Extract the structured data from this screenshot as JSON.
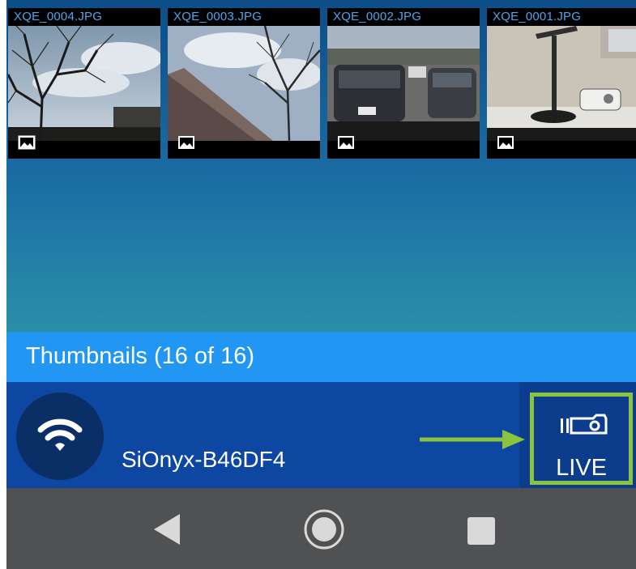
{
  "thumbnails": [
    {
      "filename": "XQE_0004.JPG",
      "icon": "image-icon"
    },
    {
      "filename": "XQE_0003.JPG",
      "icon": "image-icon"
    },
    {
      "filename": "XQE_0002.JPG",
      "icon": "image-icon"
    },
    {
      "filename": "XQE_0001.JPG",
      "icon": "image-icon"
    }
  ],
  "banner": {
    "title": "Thumbnails (16 of 16)"
  },
  "connection": {
    "ssid": "SiOnyx-B46DF4",
    "icon": "wifi-icon"
  },
  "live_button": {
    "label": "LIVE",
    "icon": "camera-icon"
  },
  "annotation": {
    "icon": "arrow-right-icon",
    "color": "#8ac43f"
  },
  "navbar": {
    "back_icon": "back-triangle-icon",
    "home_icon": "home-circle-icon",
    "recents_icon": "recents-square-icon"
  },
  "colors": {
    "banner": "#2196f3",
    "bottom_bar": "#0d47a1",
    "filename_text": "#4fa6ea",
    "navbar": "#4f5153",
    "highlight": "#8ac43f"
  }
}
